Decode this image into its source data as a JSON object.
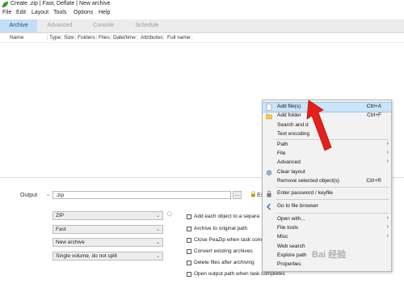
{
  "window": {
    "title": "Create .zip | Fast, Deflate | New archive"
  },
  "menubar": [
    "File",
    "Edit",
    "Layout",
    "Tools",
    "Options",
    "Help"
  ],
  "tabs": [
    "Archive",
    "Advanced",
    "Console",
    "Schedule"
  ],
  "columns": [
    "Name",
    "Type",
    "Size",
    "Folders",
    "Files",
    "Date/time",
    "Attributes",
    "Full name"
  ],
  "output": {
    "label": "Output",
    "value": ".zip",
    "browse": "...",
    "extra_label": "Ex"
  },
  "selects": {
    "format": "ZIP",
    "compression": "Fast",
    "archive_mode": "New archive",
    "volume": "Single volume, do not split"
  },
  "options": [
    "Add each object to a separa",
    "Archive to original path",
    "Close PeaZip when task com",
    "Convert existing archives",
    "Delete files after archiving",
    "Open output path when task completes"
  ],
  "context_menu": {
    "items": [
      {
        "label": "Add file(s)",
        "shortcut": "Ctrl+A",
        "icon": "file-icon"
      },
      {
        "label": "Add folder",
        "shortcut": "Ctrl+F",
        "icon": "folder-icon"
      },
      {
        "label": "Search and d",
        "shortcut": ""
      },
      {
        "label": "Text encoding",
        "shortcut": ""
      },
      {
        "label": "Path",
        "shortcut": ""
      },
      {
        "label": "File",
        "shortcut": ""
      },
      {
        "label": "Advanced",
        "shortcut": ""
      },
      {
        "label": "Clear layout",
        "shortcut": "",
        "icon": "clear-icon"
      },
      {
        "label": "Remove selected object(s)",
        "shortcut": "Ctrl+R"
      },
      {
        "label": "Enter password / keyfile",
        "shortcut": "",
        "icon": "lock-icon"
      },
      {
        "label": "Go to file browser",
        "shortcut": "",
        "icon": "back-arrow-icon"
      },
      {
        "label": "Open with...",
        "shortcut": ""
      },
      {
        "label": "File tools",
        "shortcut": ""
      },
      {
        "label": "Misc",
        "shortcut": ""
      },
      {
        "label": "Web search",
        "shortcut": ""
      },
      {
        "label": "Explore path",
        "shortcut": ""
      },
      {
        "label": "Properties",
        "shortcut": ""
      }
    ]
  },
  "watermark": "Bai 经验"
}
